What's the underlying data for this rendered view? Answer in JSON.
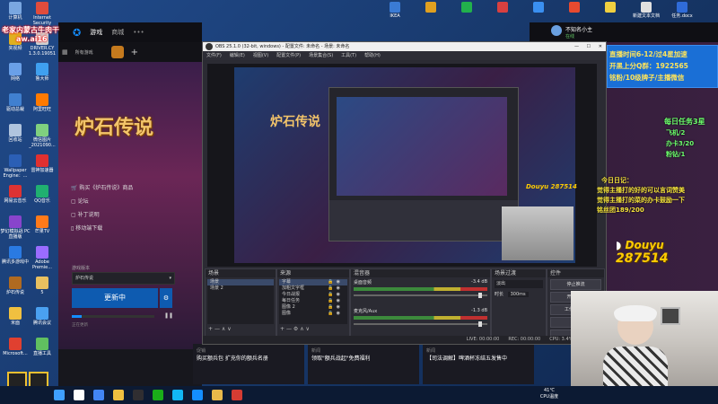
{
  "desktop": {
    "icons": [
      {
        "label": "计算机",
        "color": "#7aa7e0"
      },
      {
        "label": "Internet Security",
        "color": "#e04c3c"
      },
      {
        "label": "夹视频",
        "color": "#e0b020"
      },
      {
        "label": "DRIVER.CY 1.3.0.19051",
        "color": "#d0d0d0"
      },
      {
        "label": "网络",
        "color": "#6aa0e8"
      },
      {
        "label": "鲁大师",
        "color": "#3fa0f0"
      },
      {
        "label": "驱动总裁",
        "color": "#4080d0"
      },
      {
        "label": "阿里旺旺",
        "color": "#ff7a00"
      },
      {
        "label": "回收站",
        "color": "#b0c4de"
      },
      {
        "label": "微信图片_2021090...",
        "color": "#7fd07f"
      },
      {
        "label": "Wallpaper Engine：...",
        "color": "#2b5fb5"
      },
      {
        "label": "雷神加速器",
        "color": "#e03030"
      },
      {
        "label": "网易云音乐",
        "color": "#d33"
      },
      {
        "label": "QQ音乐",
        "color": "#20b070"
      },
      {
        "label": "梦幻模拟战 PC直播版",
        "color": "#8844cc"
      },
      {
        "label": "芒果TV",
        "color": "#ff7a1a"
      },
      {
        "label": "腾讯多游戏中",
        "color": "#2a7ae2"
      },
      {
        "label": "Adobe Premie...",
        "color": "#9a6cff"
      },
      {
        "label": "炉石传说",
        "color": "#b06a20"
      },
      {
        "label": "5",
        "color": "#e8c060"
      },
      {
        "label": "米面",
        "color": "#f0c040"
      },
      {
        "label": "腾讯会议",
        "color": "#4aa0f0"
      },
      {
        "label": "Microsoft...",
        "color": "#e04030"
      },
      {
        "label": "直播工具",
        "color": "#60c060"
      }
    ],
    "right_icons": [
      {
        "label": "IKEA",
        "color": "#3a7bd5"
      },
      {
        "label": "",
        "color": "#e0a020"
      },
      {
        "label": "",
        "color": "#22b14c"
      },
      {
        "label": "",
        "color": "#d84040"
      },
      {
        "label": "",
        "color": "#3a8ff0"
      },
      {
        "label": "",
        "color": "#e84a2f"
      },
      {
        "label": "",
        "color": "#f0d040"
      },
      {
        "label": "新建文本文档",
        "color": "#e0e0e0"
      },
      {
        "label": "任务.docx",
        "color": "#2f6bd8"
      }
    ]
  },
  "overlay": {
    "top_left_line1": "老家内蒙古牛肉干",
    "top_left_line2": "aw.ai16",
    "top_right_box": [
      "直播时间6-12/过4星加速",
      "开黑上分Q群：1922565",
      "铭粉/10级牌子/主播微信"
    ],
    "daily_tasks_title": "每日任务3星",
    "daily_tasks": [
      "飞机/2",
      "办卡3/20",
      "粉钻/1"
    ],
    "diary_title": "今日日记：",
    "diary_lines": [
      "觉得主播打的好的可以言词赞美",
      "觉得主播打的菜的办卡鼓励一下",
      "铭丝团189/200"
    ],
    "douyu_logo": "Douyu",
    "room_number": "287514"
  },
  "battlenet": {
    "tabs": [
      "游戏",
      "商城"
    ],
    "all_games": "所有游戏",
    "game_title": "炉石传说",
    "links": [
      "购买《炉石传说》商品",
      "论坛",
      "补丁说明",
      "移动端下载"
    ],
    "version_label": "游戏版本",
    "version_value": "炉石传说",
    "update_button": "更新中",
    "progress_text": "正在更新",
    "progress_fraction": 0.12,
    "user_name": "不知名小主",
    "user_status": "在线",
    "news": [
      {
        "tag": "促销",
        "title": "购买额兵包 扩充你的额兵名册"
      },
      {
        "tag": "新闻",
        "title": "领取\"额兵战起\"免费福利"
      },
      {
        "tag": "新闻",
        "title": "【司法调解】啤酒杯冻结五发售中"
      }
    ]
  },
  "obs": {
    "title": "OBS 25.1.0 (32-bit, windows) - 配置文件: 未命名 - 场景: 未命名",
    "menu": [
      "文件(F)",
      "编辑(E)",
      "视图(V)",
      "配置文件(P)",
      "场景集合(S)",
      "工具(T)",
      "帮助(H)"
    ],
    "docks": {
      "scenes": {
        "title": "场景",
        "items": [
          "场景",
          "场景 2"
        ]
      },
      "sources": {
        "title": "来源",
        "items": [
          "字幕",
          "加粗文字框",
          "今日战报",
          "每日任务",
          "图像 2",
          "图像"
        ]
      },
      "mixer": {
        "title": "混音器",
        "channels": [
          {
            "name": "桌面音频",
            "db": "-3.4 dB"
          },
          {
            "name": "麦克风/Aux",
            "db": "-1.3 dB"
          }
        ]
      },
      "transitions": {
        "title": "场景过渡",
        "type": "淡出",
        "duration_label": "时长",
        "duration": "300ms"
      },
      "controls": {
        "title": "控件",
        "buttons": [
          "停止推流",
          "开始录制",
          "工作室模式",
          "设置",
          "退出"
        ]
      }
    },
    "status": [
      "LIVE: 00:00:00",
      "REC: 00:00:00",
      "CPU: 3.4%, 30.00 fps"
    ]
  },
  "taskbar": {
    "clock_time": "41℃",
    "clock_sub": "CPU温度",
    "icons": [
      {
        "name": "start-icon",
        "color": "#3fa0ff"
      },
      {
        "name": "cortana-icon",
        "color": "#ffffff"
      },
      {
        "name": "chrome-icon",
        "color": "#4285f4"
      },
      {
        "name": "explorer-icon",
        "color": "#f0c040"
      },
      {
        "name": "obs-icon",
        "color": "#302e31"
      },
      {
        "name": "wechat-icon",
        "color": "#1aad19"
      },
      {
        "name": "qq-icon",
        "color": "#12b7f5"
      },
      {
        "name": "battlenet-icon",
        "color": "#148eff"
      },
      {
        "name": "folder-icon",
        "color": "#e8b84a"
      },
      {
        "name": "music-icon",
        "color": "#d43c33"
      }
    ]
  }
}
